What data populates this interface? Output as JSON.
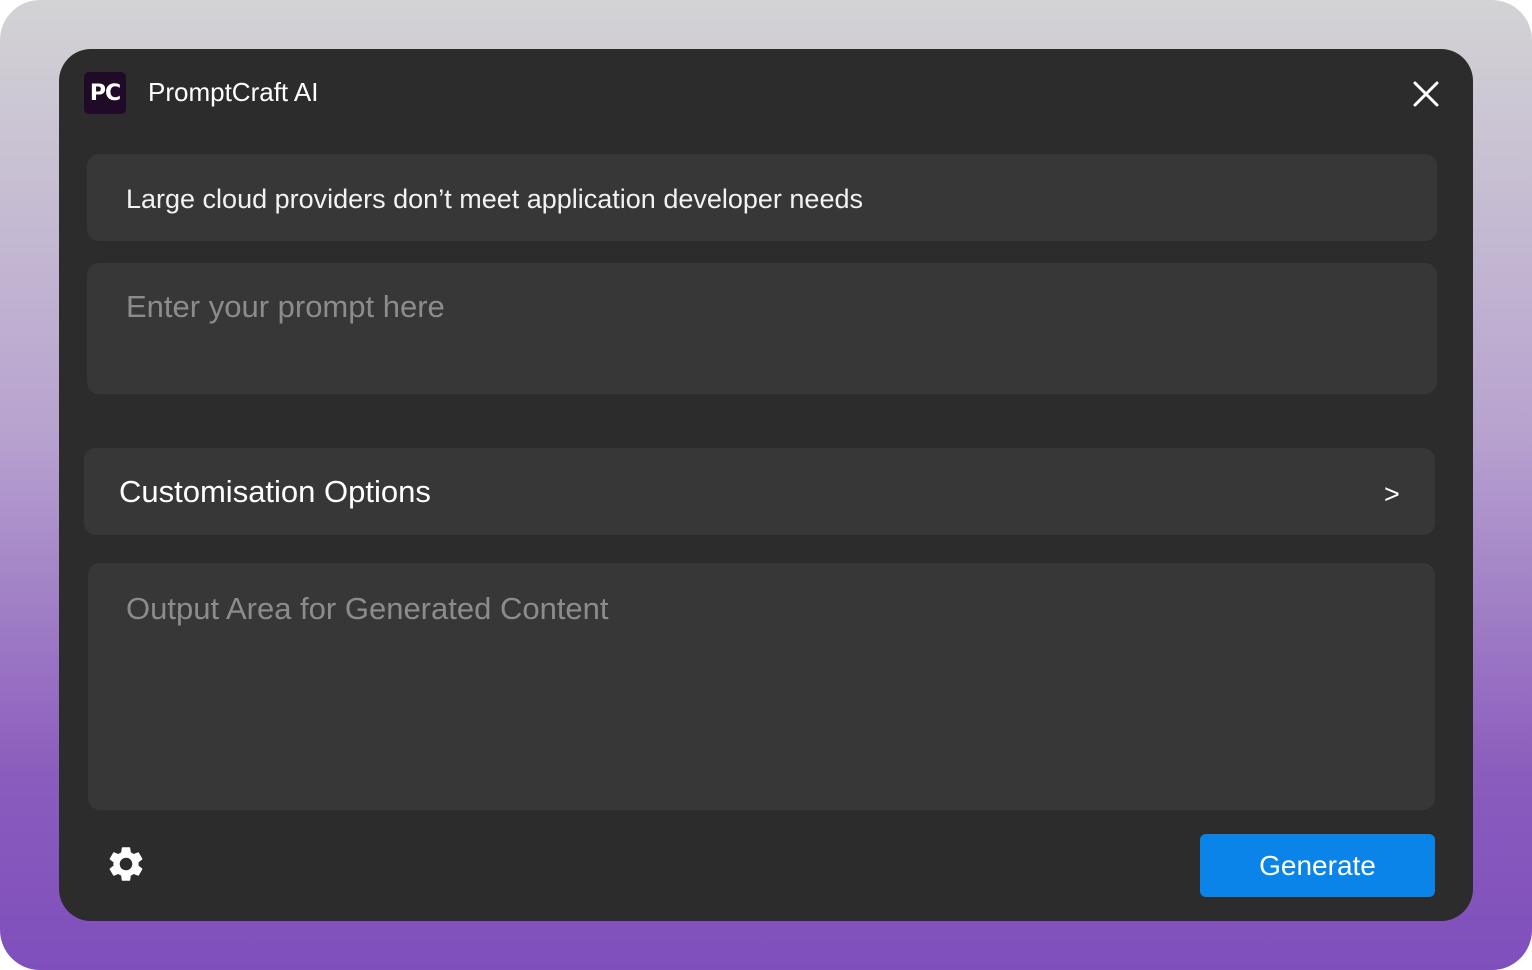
{
  "app": {
    "logo_text": "PC",
    "title": "PromptCraft AI"
  },
  "topic": {
    "value": "Large cloud providers don’t meet application developer needs"
  },
  "prompt": {
    "placeholder": "Enter your prompt here",
    "value": ""
  },
  "customisation": {
    "label": "Customisation Options",
    "chevron": ">"
  },
  "output": {
    "placeholder": "Output Area for Generated Content"
  },
  "actions": {
    "generate_label": "Generate",
    "settings_icon": "gear-icon",
    "close_icon": "close-icon"
  },
  "colors": {
    "window_bg": "#2c2c2c",
    "field_bg": "#373737",
    "accent": "#0a84e8",
    "logo_bg": "#1f0a27",
    "gradient_top": "#d3d3d5",
    "gradient_bottom": "#7f4fbc"
  }
}
